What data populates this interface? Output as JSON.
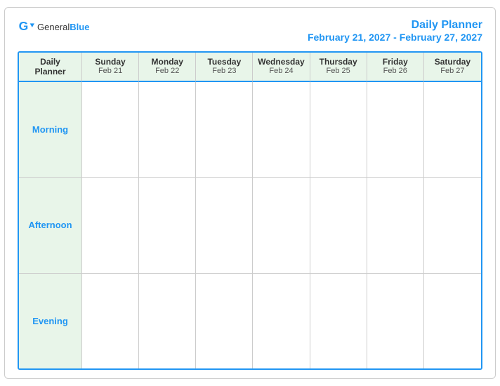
{
  "header": {
    "logo": {
      "general": "General",
      "blue": "Blue"
    },
    "title": "Daily Planner",
    "date_range": "February 21, 2027 - February 27, 2027"
  },
  "calendar": {
    "first_col": {
      "line1": "Daily",
      "line2": "Planner"
    },
    "columns": [
      {
        "day": "Sunday",
        "date": "Feb 21"
      },
      {
        "day": "Monday",
        "date": "Feb 22"
      },
      {
        "day": "Tuesday",
        "date": "Feb 23"
      },
      {
        "day": "Wednesday",
        "date": "Feb 24"
      },
      {
        "day": "Thursday",
        "date": "Feb 25"
      },
      {
        "day": "Friday",
        "date": "Feb 26"
      },
      {
        "day": "Saturday",
        "date": "Feb 27"
      }
    ],
    "rows": [
      {
        "label": "Morning"
      },
      {
        "label": "Afternoon"
      },
      {
        "label": "Evening"
      }
    ]
  }
}
